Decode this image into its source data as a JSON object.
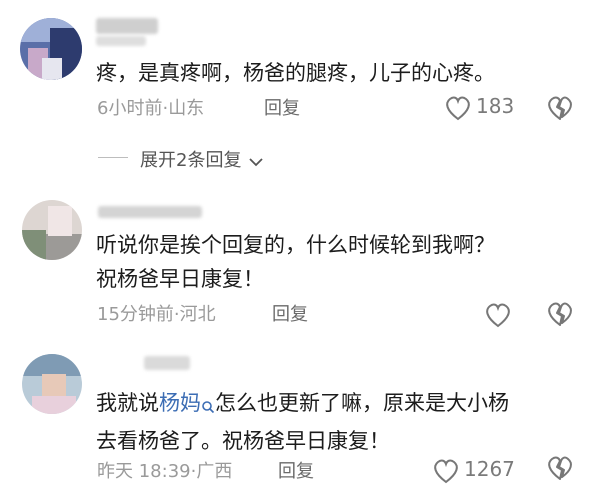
{
  "comments": [
    {
      "text_lines": [
        "疼，是真疼啊，杨爸的腿疼，儿子的心疼。"
      ],
      "time": "6小时前",
      "location": "山东",
      "reply_label": "回复",
      "likes": "183"
    },
    {
      "text_lines": [
        "听说你是挨个回复的，什么时候轮到我啊？",
        "祝杨爸早日康复！"
      ],
      "time": "15分钟前",
      "location": "河北",
      "reply_label": "回复"
    },
    {
      "text_before_link": "我就说",
      "link_text": "杨妈",
      "text_after_link": "怎么也更新了嘛，原来是大小杨",
      "text_line2": "去看杨爸了。祝杨爸早日康复！",
      "time": "昨天 18:39",
      "location": "广西",
      "reply_label": "回复",
      "likes": "1267"
    }
  ],
  "expand_replies": "展开2条回复",
  "separator_dot": "·",
  "colors": {
    "link": "#3c6db4",
    "meta": "#9a9a9a"
  }
}
